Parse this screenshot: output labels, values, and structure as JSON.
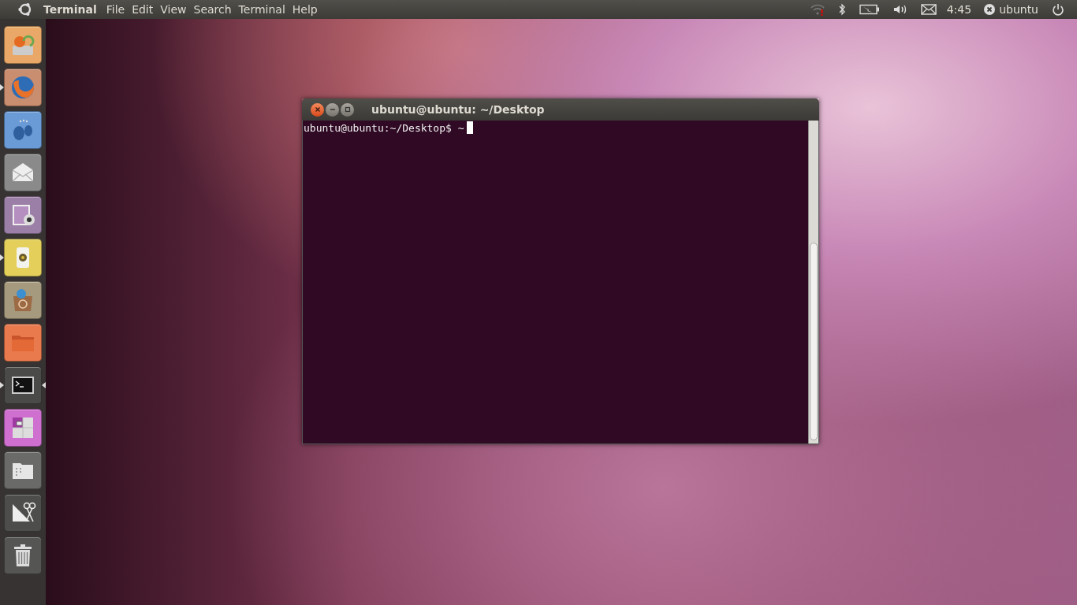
{
  "top_panel": {
    "app_name": "Terminal",
    "menus": [
      "File",
      "Edit",
      "View",
      "Search",
      "Terminal",
      "Help"
    ],
    "clock": "4:45",
    "user": "ubuntu"
  },
  "launcher": [
    {
      "kind": "installer",
      "color": "#e9a867",
      "running": false,
      "focused": false
    },
    {
      "kind": "browser",
      "color": "#c98d6f",
      "running": true,
      "focused": false
    },
    {
      "kind": "chat",
      "color": "#6b9bd6",
      "running": false,
      "focused": false
    },
    {
      "kind": "mail",
      "color": "#8a8a8a",
      "running": false,
      "focused": false
    },
    {
      "kind": "webcam",
      "color": "#9c7fa6",
      "running": false,
      "focused": false
    },
    {
      "kind": "audio",
      "color": "#e3cf5a",
      "running": true,
      "focused": false
    },
    {
      "kind": "software",
      "color": "#a69a7e",
      "running": false,
      "focused": false
    },
    {
      "kind": "folder",
      "color": "#e97a4e",
      "running": false,
      "focused": false
    },
    {
      "kind": "terminal",
      "color": "#4a4a48",
      "running": true,
      "focused": true
    },
    {
      "kind": "workspaces",
      "color": "#cf6fd0",
      "running": false,
      "focused": false
    },
    {
      "kind": "files",
      "color": "#6a6a68",
      "running": false,
      "focused": false
    },
    {
      "kind": "tools",
      "color": "#4d4d4b",
      "running": false,
      "focused": false
    },
    {
      "kind": "trash",
      "color": "#555553",
      "running": false,
      "focused": false
    }
  ],
  "terminal_window": {
    "title": "ubuntu@ubuntu: ~/Desktop",
    "lines": [
      "ubuntu@ubuntu:~/Desktop$ ~"
    ]
  }
}
